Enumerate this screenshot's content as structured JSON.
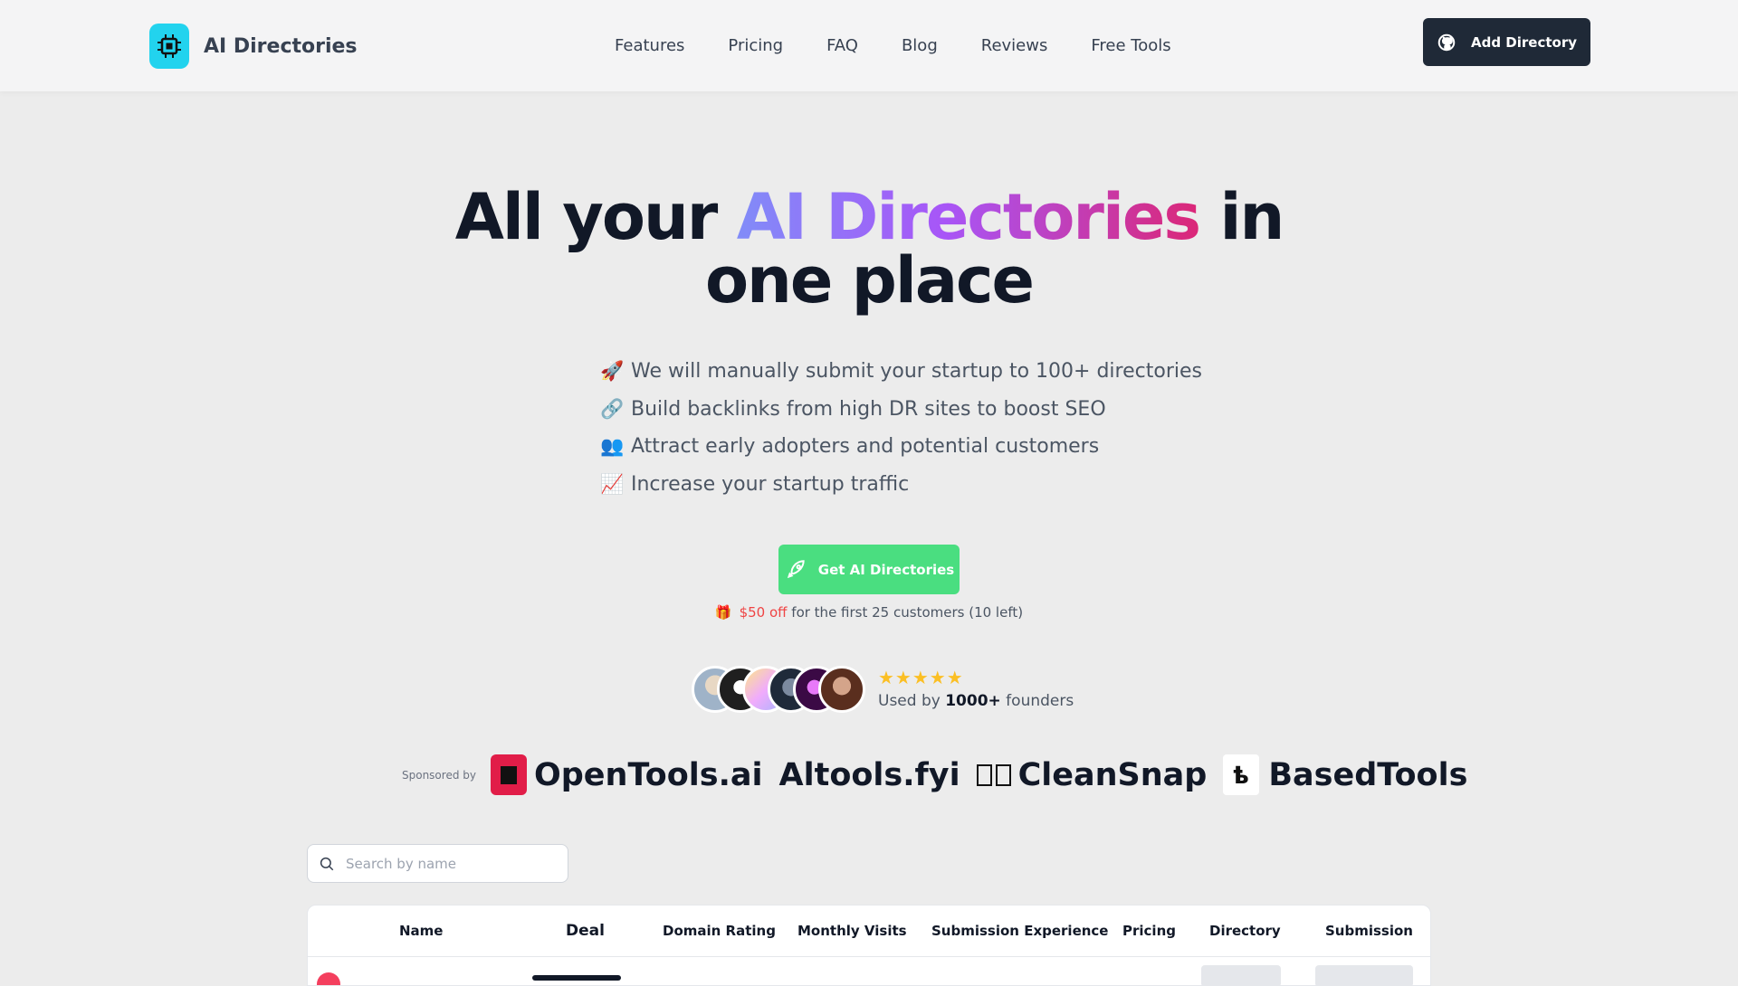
{
  "nav": {
    "brand": "AI Directories",
    "links": [
      "Features",
      "Pricing",
      "FAQ",
      "Blog",
      "Reviews",
      "Free Tools"
    ],
    "add_button": "Add Directory"
  },
  "hero": {
    "title_part1": "All your ",
    "title_highlight": "AI Directories",
    "title_part2": " in",
    "title_line2": "one place",
    "features": [
      {
        "emoji": "🚀",
        "text": "We will manually submit your startup to 100+ directories"
      },
      {
        "emoji": "🔗",
        "text": "Build backlinks from high DR sites to boost SEO"
      },
      {
        "emoji": "👥",
        "text": "Attract early adopters and potential customers"
      },
      {
        "emoji": "📈",
        "text": "Increase your startup traffic"
      }
    ],
    "cta_label": "Get AI Directories",
    "offer_highlight": "$50 off",
    "offer_rest": " for the first 25 customers (10 left)"
  },
  "social_proof": {
    "stars": "★★★★★",
    "used_prefix": "Used by ",
    "used_count": "1000+",
    "used_suffix": " founders",
    "avatar_colors": [
      "#d6c7b4",
      "#1f1f1f",
      "#f5e6ff",
      "#34475e",
      "#6b2a7a",
      "#7a3b2a"
    ]
  },
  "sponsors": {
    "label": "Sponsored by",
    "items": [
      "OpenTools.ai",
      "Altools.fyi",
      "CleanSnap",
      "BasedTools"
    ]
  },
  "search": {
    "placeholder": "Search by name"
  },
  "table": {
    "columns": [
      "Name",
      "Deal",
      "Domain Rating",
      "Monthly Visits",
      "Submission Experience",
      "Pricing",
      "Directory",
      "Submission"
    ]
  },
  "colors": {
    "brand_cyan": "#22d3ee",
    "cta_green": "#4ade80",
    "dark_button": "#1f2937",
    "gradient_start": "#818cf8",
    "gradient_end": "#db2777"
  }
}
